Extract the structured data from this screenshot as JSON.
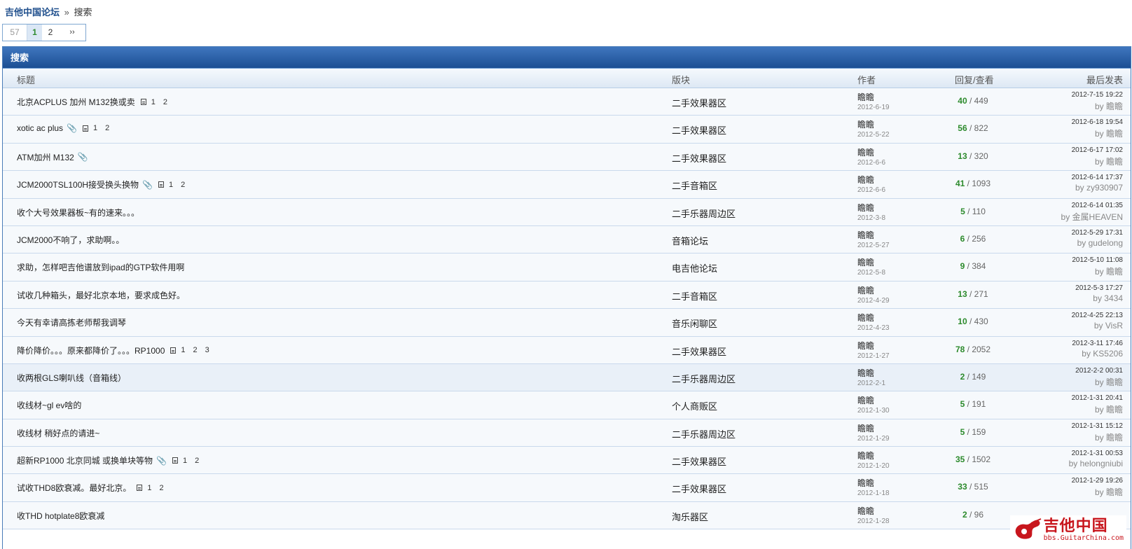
{
  "breadcrumb": {
    "home": "吉他中国论坛",
    "separator": "»",
    "current": "搜索"
  },
  "pager": {
    "count": "57",
    "current": "1",
    "pages": [
      "2"
    ],
    "next": "››"
  },
  "panel": {
    "title": "搜索"
  },
  "columns": {
    "title": "标题",
    "forum": "版块",
    "author": "作者",
    "stats": "回复/查看",
    "last": "最后发表"
  },
  "threads": [
    {
      "title": "北京ACPLUS 加州 M132换或卖",
      "attach": false,
      "pages": [
        "1",
        "2"
      ],
      "forum": "二手效果器区",
      "author": "瞻瞻",
      "date": "2012-6-19",
      "replies": "40",
      "views": "449",
      "last_time": "2012-7-15 19:22",
      "last_by": "by 瞻瞻"
    },
    {
      "title": "xotic ac plus",
      "attach": true,
      "pages": [
        "1",
        "2"
      ],
      "forum": "二手效果器区",
      "author": "瞻瞻",
      "date": "2012-5-22",
      "replies": "56",
      "views": "822",
      "last_time": "2012-6-18 19:54",
      "last_by": "by 瞻瞻"
    },
    {
      "title": "ATM加州 M132",
      "attach": true,
      "pages": [],
      "forum": "二手效果器区",
      "author": "瞻瞻",
      "date": "2012-6-6",
      "replies": "13",
      "views": "320",
      "last_time": "2012-6-17 17:02",
      "last_by": "by 瞻瞻"
    },
    {
      "title": "JCM2000TSL100H接受换头换物",
      "attach": true,
      "pages": [
        "1",
        "2"
      ],
      "forum": "二手音箱区",
      "author": "瞻瞻",
      "date": "2012-6-6",
      "replies": "41",
      "views": "1093",
      "last_time": "2012-6-14 17:37",
      "last_by": "by zy930907"
    },
    {
      "title": "收个大号效果器板~有的速来。。。",
      "attach": false,
      "pages": [],
      "forum": "二手乐器周边区",
      "author": "瞻瞻",
      "date": "2012-3-8",
      "replies": "5",
      "views": "110",
      "last_time": "2012-6-14 01:35",
      "last_by": "by 金属HEAVEN"
    },
    {
      "title": "JCM2000不响了，求助啊。。",
      "attach": false,
      "pages": [],
      "forum": "音箱论坛",
      "author": "瞻瞻",
      "date": "2012-5-27",
      "replies": "6",
      "views": "256",
      "last_time": "2012-5-29 17:31",
      "last_by": "by gudelong"
    },
    {
      "title": "求助，怎样吧吉他谱放到ipad的GTP软件用啊",
      "attach": false,
      "pages": [],
      "forum": "电吉他论坛",
      "author": "瞻瞻",
      "date": "2012-5-8",
      "replies": "9",
      "views": "384",
      "last_time": "2012-5-10 11:08",
      "last_by": "by 瞻瞻"
    },
    {
      "title": "试收几种箱头，最好北京本地，要求成色好。",
      "attach": false,
      "pages": [],
      "forum": "二手音箱区",
      "author": "瞻瞻",
      "date": "2012-4-29",
      "replies": "13",
      "views": "271",
      "last_time": "2012-5-3 17:27",
      "last_by": "by 3434"
    },
    {
      "title": "今天有幸请高拣老师帮我调琴",
      "attach": false,
      "pages": [],
      "forum": "音乐闲聊区",
      "author": "瞻瞻",
      "date": "2012-4-23",
      "replies": "10",
      "views": "430",
      "last_time": "2012-4-25 22:13",
      "last_by": "by VisR"
    },
    {
      "title": "降价降价。。。原来都降价了。。。RP1000",
      "attach": false,
      "pages": [
        "1",
        "2",
        "3"
      ],
      "forum": "二手效果器区",
      "author": "瞻瞻",
      "date": "2012-1-27",
      "replies": "78",
      "views": "2052",
      "last_time": "2012-3-11 17:46",
      "last_by": "by KS5206"
    },
    {
      "title": "收两根GLS喇叭线（音箱线）",
      "attach": false,
      "pages": [],
      "forum": "二手乐器周边区",
      "author": "瞻瞻",
      "date": "2012-2-1",
      "replies": "2",
      "views": "149",
      "last_time": "2012-2-2 00:31",
      "last_by": "by 瞻瞻"
    },
    {
      "title": "收线材~gl ev啥的",
      "attach": false,
      "pages": [],
      "forum": "个人商贩区",
      "author": "瞻瞻",
      "date": "2012-1-30",
      "replies": "5",
      "views": "191",
      "last_time": "2012-1-31 20:41",
      "last_by": "by 瞻瞻"
    },
    {
      "title": "收线材 稍好点的请进~",
      "attach": false,
      "pages": [],
      "forum": "二手乐器周边区",
      "author": "瞻瞻",
      "date": "2012-1-29",
      "replies": "5",
      "views": "159",
      "last_time": "2012-1-31 15:12",
      "last_by": "by 瞻瞻"
    },
    {
      "title": "超新RP1000 北京同城 或换单块等物",
      "attach": true,
      "pages": [
        "1",
        "2"
      ],
      "forum": "二手效果器区",
      "author": "瞻瞻",
      "date": "2012-1-20",
      "replies": "35",
      "views": "1502",
      "last_time": "2012-1-31 00:53",
      "last_by": "by helongniubi"
    },
    {
      "title": "试收THD8欧衰减。最好北京。",
      "attach": false,
      "pages": [
        "1",
        "2"
      ],
      "forum": "二手效果器区",
      "author": "瞻瞻",
      "date": "2012-1-18",
      "replies": "33",
      "views": "515",
      "last_time": "2012-1-29 19:26",
      "last_by": "by 瞻瞻"
    },
    {
      "title": "收THD hotplate8欧衰减",
      "attach": false,
      "pages": [],
      "forum": "淘乐器区",
      "author": "瞻瞻",
      "date": "2012-1-28",
      "replies": "2",
      "views": "96",
      "last_time": "",
      "last_by": ""
    }
  ],
  "watermark": {
    "name": "吉他中国",
    "url": "bbs.GuitarChina.com",
    "color": "#c8161d"
  },
  "icons": {
    "page": "page-icon",
    "attachment": "paperclip-icon"
  }
}
